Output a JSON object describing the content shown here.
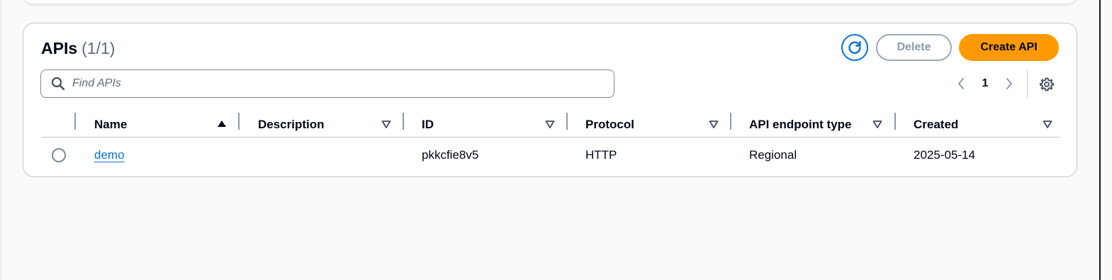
{
  "panel": {
    "title": "APIs",
    "count": "(1/1)"
  },
  "actions": {
    "refresh_icon": "refresh-icon",
    "delete_label": "Delete",
    "create_label": "Create API"
  },
  "search": {
    "placeholder": "Find APIs",
    "value": ""
  },
  "pagination": {
    "current_page": "1"
  },
  "table": {
    "columns": [
      {
        "label": "Name",
        "sort": "ascending"
      },
      {
        "label": "Description",
        "sort": "none"
      },
      {
        "label": "ID",
        "sort": "none"
      },
      {
        "label": "Protocol",
        "sort": "none"
      },
      {
        "label": "API endpoint type",
        "sort": "none"
      },
      {
        "label": "Created",
        "sort": "none"
      }
    ],
    "rows": [
      {
        "selected": false,
        "name": "demo",
        "description": "",
        "id": "pkkcfie8v5",
        "protocol": "HTTP",
        "endpoint_type": "Regional",
        "created": "2025-05-14"
      }
    ]
  },
  "colors": {
    "accent": "#0972d3",
    "primary_button": "#ff9900",
    "border": "#c6c6cd"
  }
}
